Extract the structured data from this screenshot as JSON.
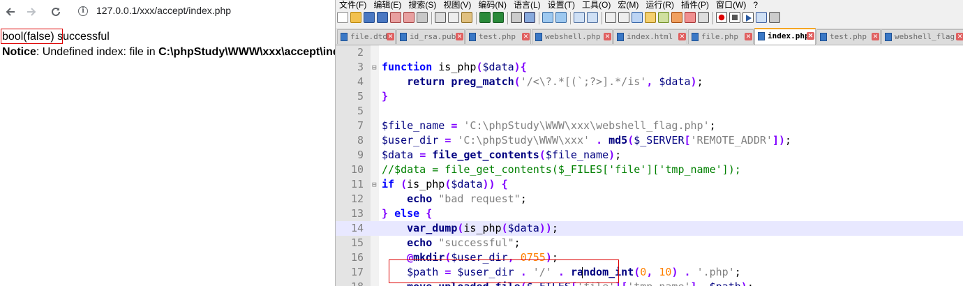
{
  "browser": {
    "url": "127.0.0.1/xxx/accept/index.php",
    "output": {
      "line1_boxed": "bool(false)",
      "line1_rest": " successful",
      "line2_notice_label": "Notice",
      "line2_text": ": Undefined index: file in ",
      "line2_path": "C:\\phpStudy\\WWW\\xxx\\accept\\index.php"
    }
  },
  "editor": {
    "menu": [
      "文件(F)",
      "编辑(E)",
      "搜索(S)",
      "视图(V)",
      "编码(N)",
      "语言(L)",
      "设置(T)",
      "工具(O)",
      "宏(M)",
      "运行(R)",
      "插件(P)",
      "窗口(W)",
      "?"
    ],
    "tabs": [
      {
        "label": "file.dtd",
        "active": false
      },
      {
        "label": "id_rsa.pub",
        "active": false
      },
      {
        "label": "test.php",
        "active": false
      },
      {
        "label": "webshell.php",
        "active": false
      },
      {
        "label": "index.html",
        "active": false
      },
      {
        "label": "file.php",
        "active": false
      },
      {
        "label": "index.php",
        "active": true
      },
      {
        "label": "test.php",
        "active": false
      },
      {
        "label": "webshell_flag.php",
        "active": false
      }
    ],
    "colors": {
      "keyword": "#0000ff",
      "builtin": "#000080",
      "string": "#808080",
      "variable": "#000080",
      "number": "#ff8000",
      "comment": "#008000",
      "operator": "#8000ff",
      "highlight": "#dd0000",
      "current_line": "#e8e8ff"
    },
    "current_line": 14,
    "highlighted_line": 14,
    "lines": [
      {
        "n": "2",
        "fold": "",
        "tokens": []
      },
      {
        "n": "3",
        "fold": "⊟",
        "tokens": [
          [
            "k",
            "function"
          ],
          [
            "p",
            " is_php"
          ],
          [
            "o",
            "("
          ],
          [
            "v",
            "$data"
          ],
          [
            "o",
            ")"
          ],
          [
            "o",
            "{"
          ]
        ]
      },
      {
        "n": "4",
        "fold": "",
        "tokens": [
          [
            "p",
            "    "
          ],
          [
            "b",
            "return"
          ],
          [
            "p",
            " "
          ],
          [
            "b",
            "preg_match"
          ],
          [
            "o",
            "("
          ],
          [
            "s",
            "'/<\\?.*[(`;?>].*/is'"
          ],
          [
            "o",
            ","
          ],
          [
            "p",
            " "
          ],
          [
            "v",
            "$data"
          ],
          [
            "o",
            ")"
          ],
          [
            "p",
            ";"
          ]
        ]
      },
      {
        "n": "5",
        "fold": "",
        "tokens": [
          [
            "o",
            "}"
          ]
        ]
      },
      {
        "n": "5",
        "fold": "",
        "tokens": []
      },
      {
        "n": "7",
        "fold": "",
        "tokens": [
          [
            "v",
            "$file_name"
          ],
          [
            "p",
            " "
          ],
          [
            "o",
            "="
          ],
          [
            "p",
            " "
          ],
          [
            "s",
            "'C:\\phpStudy\\WWW\\xxx\\webshell_flag.php'"
          ],
          [
            "p",
            ";"
          ]
        ]
      },
      {
        "n": "8",
        "fold": "",
        "tokens": [
          [
            "v",
            "$user_dir"
          ],
          [
            "p",
            " "
          ],
          [
            "o",
            "="
          ],
          [
            "p",
            " "
          ],
          [
            "s",
            "'C:\\phpStudy\\WWW\\xxx'"
          ],
          [
            "p",
            " "
          ],
          [
            "o",
            "."
          ],
          [
            "p",
            " "
          ],
          [
            "b",
            "md5"
          ],
          [
            "o",
            "("
          ],
          [
            "v",
            "$_SERVER"
          ],
          [
            "o",
            "["
          ],
          [
            "s",
            "'REMOTE_ADDR'"
          ],
          [
            "o",
            "]"
          ],
          [
            "o",
            ")"
          ],
          [
            "p",
            ";"
          ]
        ]
      },
      {
        "n": "9",
        "fold": "",
        "tokens": [
          [
            "v",
            "$data"
          ],
          [
            "p",
            " "
          ],
          [
            "o",
            "="
          ],
          [
            "p",
            " "
          ],
          [
            "b",
            "file_get_contents"
          ],
          [
            "o",
            "("
          ],
          [
            "v",
            "$file_name"
          ],
          [
            "o",
            ")"
          ],
          [
            "p",
            ";"
          ]
        ]
      },
      {
        "n": "10",
        "fold": "",
        "tokens": [
          [
            "c",
            "//$data = file_get_contents($_FILES['file']['tmp_name']);"
          ]
        ]
      },
      {
        "n": "11",
        "fold": "⊟",
        "tokens": [
          [
            "k",
            "if"
          ],
          [
            "p",
            " "
          ],
          [
            "o",
            "("
          ],
          [
            "p",
            "is_php"
          ],
          [
            "o",
            "("
          ],
          [
            "v",
            "$data"
          ],
          [
            "o",
            ")"
          ],
          [
            "o",
            ")"
          ],
          [
            "p",
            " "
          ],
          [
            "o",
            "{"
          ]
        ]
      },
      {
        "n": "12",
        "fold": "",
        "tokens": [
          [
            "p",
            "    "
          ],
          [
            "b",
            "echo"
          ],
          [
            "p",
            " "
          ],
          [
            "s",
            "\"bad request\""
          ],
          [
            "p",
            ";"
          ]
        ]
      },
      {
        "n": "13",
        "fold": "",
        "tokens": [
          [
            "o",
            "}"
          ],
          [
            "p",
            " "
          ],
          [
            "k",
            "else"
          ],
          [
            "p",
            " "
          ],
          [
            "o",
            "{"
          ]
        ]
      },
      {
        "n": "14",
        "fold": "",
        "tokens": [
          [
            "p",
            "    "
          ],
          [
            "b",
            "var_dump"
          ],
          [
            "o",
            "("
          ],
          [
            "p",
            "is_php"
          ],
          [
            "o",
            "("
          ],
          [
            "v",
            "$data"
          ],
          [
            "o",
            ")"
          ],
          [
            "o",
            ")"
          ],
          [
            "p",
            ";"
          ]
        ]
      },
      {
        "n": "15",
        "fold": "",
        "tokens": [
          [
            "p",
            "    "
          ],
          [
            "b",
            "echo"
          ],
          [
            "p",
            " "
          ],
          [
            "s",
            "\"successful\""
          ],
          [
            "p",
            ";"
          ]
        ]
      },
      {
        "n": "16",
        "fold": "",
        "tokens": [
          [
            "p",
            "    "
          ],
          [
            "o",
            "@"
          ],
          [
            "b",
            "mkdir"
          ],
          [
            "o",
            "("
          ],
          [
            "v",
            "$user_dir"
          ],
          [
            "o",
            ","
          ],
          [
            "p",
            " "
          ],
          [
            "n",
            "0755"
          ],
          [
            "o",
            ")"
          ],
          [
            "p",
            ";"
          ]
        ]
      },
      {
        "n": "17",
        "fold": "",
        "tokens": [
          [
            "p",
            "    "
          ],
          [
            "v",
            "$path"
          ],
          [
            "p",
            " "
          ],
          [
            "o",
            "="
          ],
          [
            "p",
            " "
          ],
          [
            "v",
            "$user_dir"
          ],
          [
            "p",
            " "
          ],
          [
            "o",
            "."
          ],
          [
            "p",
            " "
          ],
          [
            "s",
            "'/'"
          ],
          [
            "p",
            " "
          ],
          [
            "o",
            "."
          ],
          [
            "p",
            " "
          ],
          [
            "b",
            "random_int"
          ],
          [
            "o",
            "("
          ],
          [
            "n",
            "0"
          ],
          [
            "o",
            ","
          ],
          [
            "p",
            " "
          ],
          [
            "n",
            "10"
          ],
          [
            "o",
            ")"
          ],
          [
            "p",
            " "
          ],
          [
            "o",
            "."
          ],
          [
            "p",
            " "
          ],
          [
            "s",
            "'.php'"
          ],
          [
            "p",
            ";"
          ]
        ]
      },
      {
        "n": "18",
        "fold": "",
        "tokens": [
          [
            "p",
            "    "
          ],
          [
            "b",
            "move_uploaded_file"
          ],
          [
            "o",
            "("
          ],
          [
            "v",
            "$_FILES"
          ],
          [
            "o",
            "["
          ],
          [
            "s",
            "'file'"
          ],
          [
            "o",
            "]"
          ],
          [
            "o",
            "["
          ],
          [
            "s",
            "'tmp_name'"
          ],
          [
            "o",
            "]"
          ],
          [
            "o",
            ","
          ],
          [
            "p",
            " "
          ],
          [
            "v",
            "$path"
          ],
          [
            "o",
            ")"
          ],
          [
            "p",
            ";"
          ]
        ]
      }
    ]
  }
}
